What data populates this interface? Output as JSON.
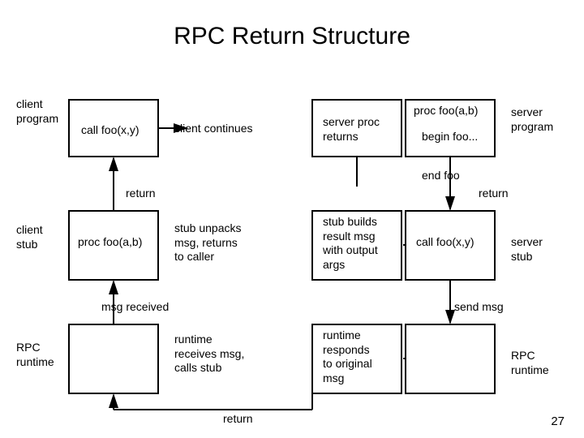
{
  "title": "RPC Return Structure",
  "page_number": "27",
  "labels": {
    "client_program": "client\nprogram",
    "server_program": "server\nprogram",
    "client_stub": "client\nstub",
    "server_stub": "server\nstub",
    "rpc_runtime_left": "RPC\nruntime",
    "rpc_runtime_right": "RPC\nruntime",
    "call_foo_xy": "call foo(x,y)",
    "client_continues": "client continues",
    "server_proc_returns": "server proc\nreturns",
    "proc_foo_ab_top": "proc foo(a,b)",
    "begin_foo": "begin foo...",
    "end_foo": "end foo",
    "return_left": "return",
    "return_right": "return",
    "proc_foo_ab_left": "proc foo(a,b)",
    "stub_unpacks": "stub unpacks\nmsg, returns\nto caller",
    "stub_builds": "stub builds\nresult msg\nwith output\nargs",
    "call_foo_xy_right": "call foo(x,y)",
    "msg_received": "msg received",
    "send_msg": "send msg",
    "runtime_receives": "runtime\nreceives msg,\ncalls stub",
    "runtime_responds": "runtime\nresponds\nto original\nmsg",
    "return_bottom": "return"
  }
}
